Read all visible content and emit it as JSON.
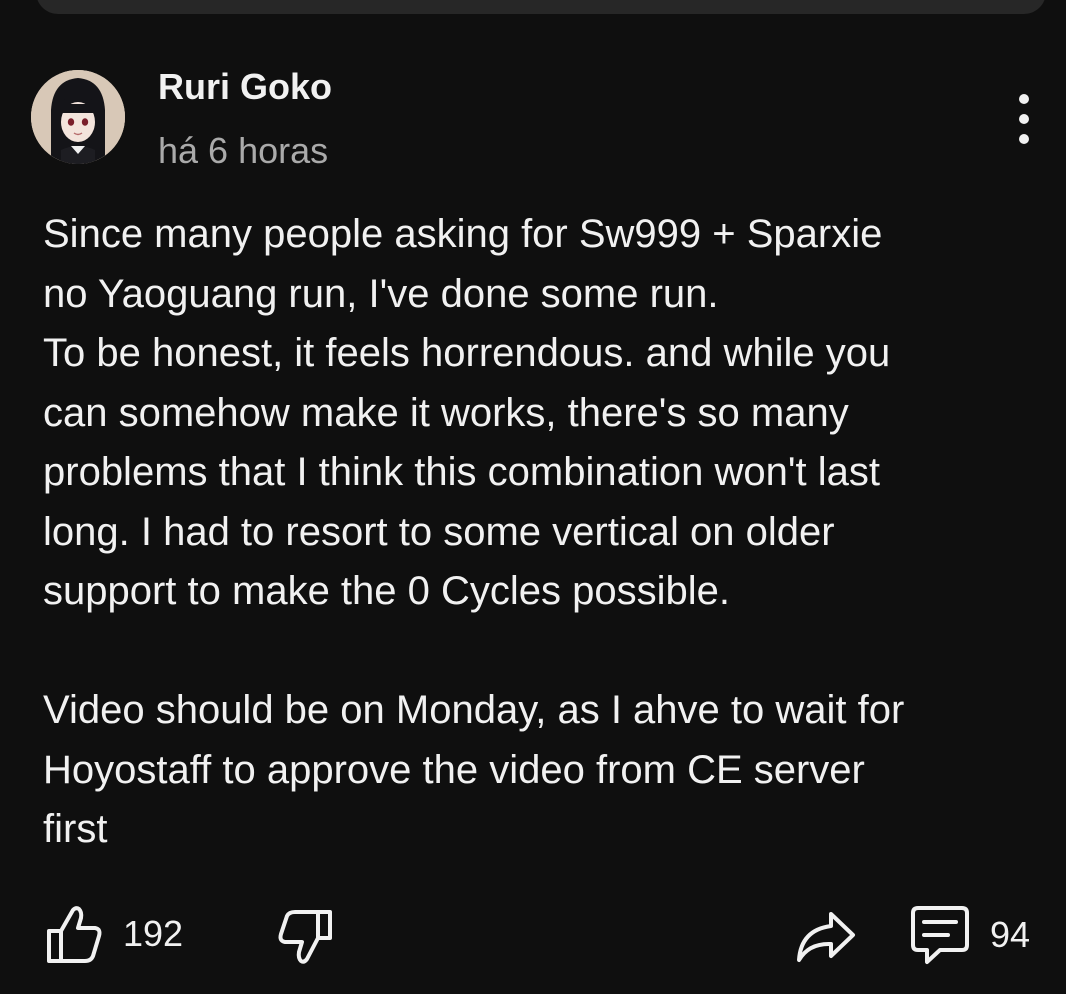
{
  "post": {
    "author": "Ruri Goko",
    "timestamp": "há 6 horas",
    "body": "Since many people asking for Sw999 + Sparxie\nno Yaoguang run, I've done some run.\nTo be honest, it feels horrendous. and while you\ncan somehow make it works, there's so many\nproblems that I think this combination won't last\nlong. I had to resort to some vertical on older\nsupport to make the 0 Cycles possible.\n\nVideo should be on Monday, as I ahve to wait for\nHoyostaff to approve the video from CE server\nfirst"
  },
  "actions": {
    "like_count": "192",
    "reply_count": "94"
  },
  "icons": {
    "more": "more-vertical-icon",
    "like": "thumbs-up-icon",
    "dislike": "thumbs-down-icon",
    "share": "share-arrow-icon",
    "reply": "comment-icon"
  },
  "colors": {
    "background": "#0f0f0f",
    "text_primary": "#f1f1f1",
    "text_secondary": "#aaaaaa",
    "card": "#272727"
  }
}
